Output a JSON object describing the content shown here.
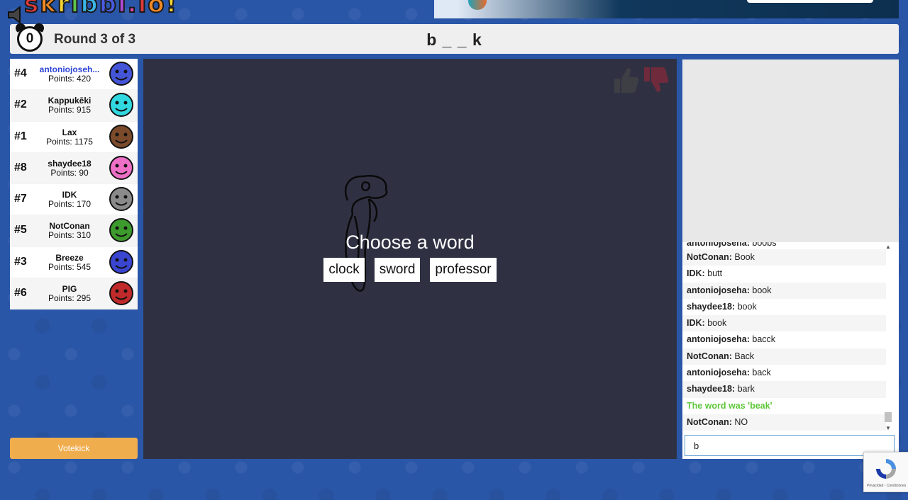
{
  "logo": {
    "letters": [
      "s",
      "k",
      "r",
      "i",
      "b",
      "b",
      "l",
      ".",
      "i",
      "o",
      "!"
    ]
  },
  "header": {
    "timer": "0",
    "round_text": "Round 3 of 3",
    "word_hint": "b _ _ k"
  },
  "players": [
    {
      "rank": "#4",
      "name": "antoniojoseh...",
      "points": "Points: 420",
      "self": true,
      "color": "#4455d8"
    },
    {
      "rank": "#2",
      "name": "Kappukēki",
      "points": "Points: 915",
      "color": "#32d8e0"
    },
    {
      "rank": "#1",
      "name": "Lax",
      "points": "Points: 1175",
      "color": "#7a4a2b"
    },
    {
      "rank": "#8",
      "name": "shaydee18",
      "points": "Points: 90",
      "color": "#ee70c6"
    },
    {
      "rank": "#7",
      "name": "IDK",
      "points": "Points: 170",
      "color": "#8a8a8a"
    },
    {
      "rank": "#5",
      "name": "NotConan",
      "points": "Points: 310",
      "color": "#3d9a2c"
    },
    {
      "rank": "#3",
      "name": "Breeze",
      "points": "Points: 545",
      "color": "#3a45d0"
    },
    {
      "rank": "#6",
      "name": "PIG",
      "points": "Points: 295",
      "color": "#c02a2a"
    }
  ],
  "votekick_label": "Votekick",
  "canvas": {
    "prompt": "Choose a word",
    "choices": [
      "clock",
      "sword",
      "professor"
    ]
  },
  "chat": {
    "messages": [
      {
        "user": "antoniojoseha:",
        "text": "boobs"
      },
      {
        "user": "NotConan:",
        "text": "Book"
      },
      {
        "user": "IDK:",
        "text": "butt"
      },
      {
        "user": "antoniojoseha:",
        "text": "book"
      },
      {
        "user": "shaydee18:",
        "text": "book"
      },
      {
        "user": "IDK:",
        "text": "book"
      },
      {
        "user": "antoniojoseha:",
        "text": "bacck"
      },
      {
        "user": "NotConan:",
        "text": "Back"
      },
      {
        "user": "antoniojoseha:",
        "text": "back"
      },
      {
        "user": "shaydee18:",
        "text": "bark"
      },
      {
        "system": "The word was 'beak'"
      },
      {
        "user": "NotConan:",
        "text": "NO"
      }
    ],
    "input_value": "b"
  },
  "recaptcha_text": "Privacidad - Condiciones",
  "colors": {
    "background": "#2a56a8",
    "canvas": "#2f3143",
    "votekick": "#f0ad4e",
    "system_msg": "#5ec73b",
    "self_name": "#2d44d6"
  }
}
